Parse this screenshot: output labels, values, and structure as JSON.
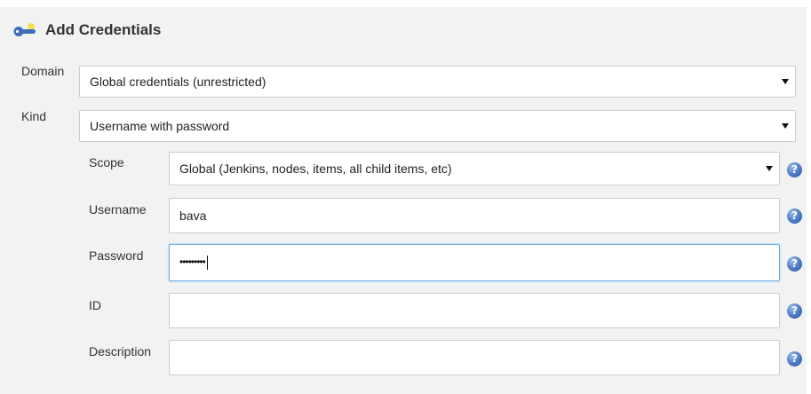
{
  "header": {
    "title": "Add Credentials",
    "icon": "key-icon"
  },
  "form": {
    "domain": {
      "label": "Domain",
      "value": "Global credentials (unrestricted)"
    },
    "kind": {
      "label": "Kind",
      "value": "Username with password"
    },
    "scope": {
      "label": "Scope",
      "value": "Global (Jenkins, nodes, items, all child items, etc)"
    },
    "username": {
      "label": "Username",
      "value": "bava"
    },
    "password": {
      "label": "Password",
      "masked_value": "•••••••••"
    },
    "id": {
      "label": "ID",
      "value": ""
    },
    "description": {
      "label": "Description",
      "value": ""
    }
  },
  "help_glyph": "?",
  "colors": {
    "panel_bg": "#f2f2f2",
    "help_blue": "#4a78c2",
    "focus_border": "#66afe9"
  }
}
